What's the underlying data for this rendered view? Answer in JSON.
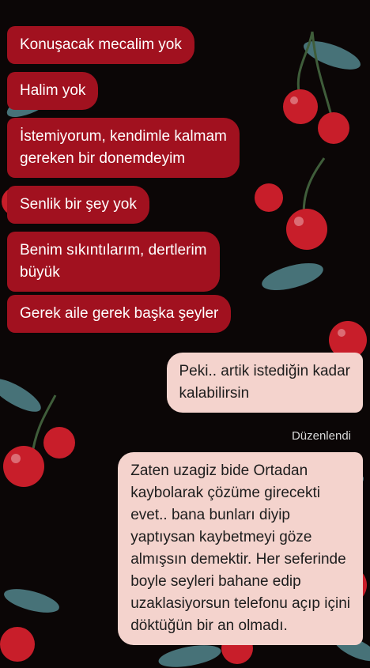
{
  "wallpaper": {
    "background": "#0b0606",
    "cherry": "#c81e2a",
    "leaf": "#4f7f86"
  },
  "messages": {
    "incoming": [
      "Konuşacak mecalim yok",
      "Halim yok",
      "İstemiyorum, kendimle kalmam\ngereken bir donemdeyim",
      "Senlik bir şey yok",
      "Benim sıkıntılarım, dertlerim\nbüyük",
      "Gerek aile gerek başka şeyler"
    ],
    "outgoing": [
      "Peki.. artik istediğin kadar\nkalabilirsin",
      "Zaten uzagiz bide Ortadan\nkaybolarak çözüme girecekti\nevet.. bana bunları diyip\nyaptıysan kaybetmeyi göze\nalmışsın demektir. Her seferinde\nboyle seyleri bahane edip\nuzaklasiyorsun telefonu açıp içini\ndöktüğün bir an olmadı."
    ],
    "edited_label": "Düzenlendi"
  }
}
